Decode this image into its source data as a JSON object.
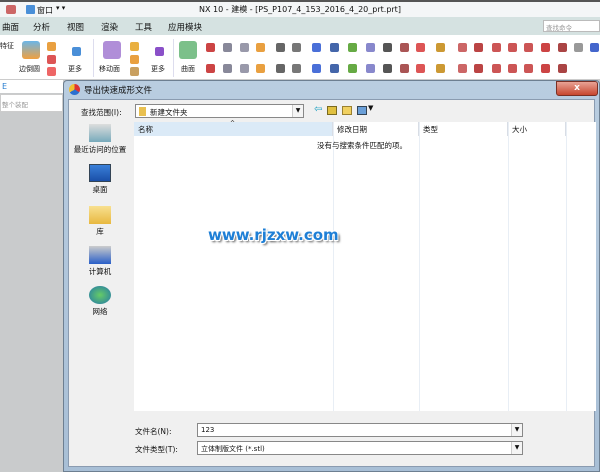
{
  "app": {
    "title": "NX 10 - 建模 - [PS_P107_4_153_2016_4_20_prt.prt]",
    "quick_access": "窗口"
  },
  "menu": [
    "曲面",
    "分析",
    "视图",
    "渲染",
    "工具",
    "应用模块"
  ],
  "search_placeholder": "查找命令",
  "ribbon": {
    "feature": "特征",
    "edge_blend": "边倒圆",
    "more1": "更多",
    "move_face": "移动面",
    "more2": "更多",
    "surface": "曲面"
  },
  "left_panel": {
    "tab": "E",
    "filter": "整个装配"
  },
  "dialog": {
    "title": "导出快速成形文件",
    "close": "x",
    "look_in_label": "查找范围(I):",
    "look_in_value": "新建文件夹",
    "places": [
      "最近访问的位置",
      "桌面",
      "库",
      "计算机",
      "网络"
    ],
    "columns": [
      "名称",
      "修改日期",
      "类型",
      "大小"
    ],
    "empty_message": "没有与搜索条件匹配的项。",
    "filename_label": "文件名(N):",
    "filename_value": "123",
    "filetype_label": "文件类型(T):",
    "filetype_value": "立体制版文件 (*.stl)"
  },
  "watermark": "www.rjzxw.com"
}
